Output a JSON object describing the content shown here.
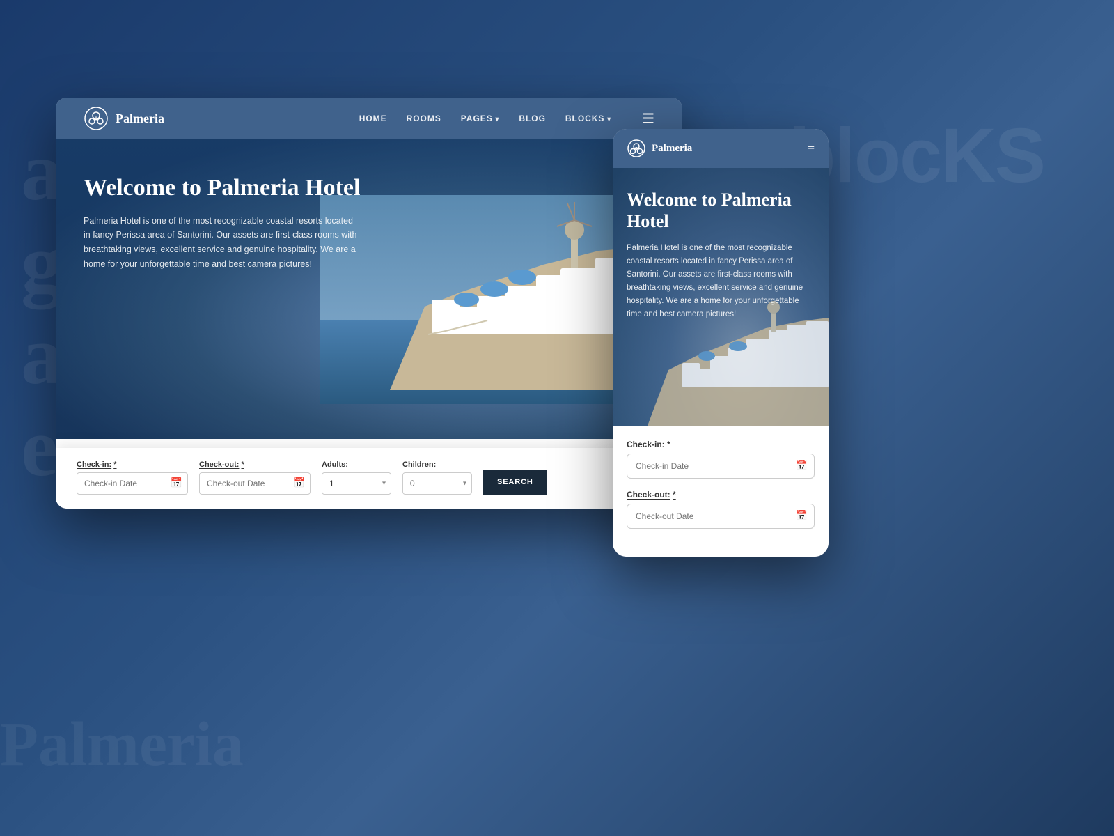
{
  "background": {
    "color": "#1e3a5f"
  },
  "watermark_text": "Palmeria",
  "blocks_text": "blocKS",
  "desktop": {
    "navbar": {
      "logo_text": "Palmeria",
      "nav_items": [
        {
          "label": "HOME",
          "has_dropdown": false
        },
        {
          "label": "ROOMS",
          "has_dropdown": false
        },
        {
          "label": "PAGES",
          "has_dropdown": true
        },
        {
          "label": "BLOG",
          "has_dropdown": false
        },
        {
          "label": "BLOCKS",
          "has_dropdown": true
        }
      ]
    },
    "hero": {
      "title": "Welcome to Palmeria Hotel",
      "description": "Palmeria Hotel is one of the most recognizable coastal resorts located in fancy Perissa area of Santorini. Our assets are first-class rooms with breathtaking views, excellent service and genuine hospitality. We are a home for your unforgettable time and best camera pictures!"
    },
    "booking": {
      "checkin_label": "Check-in:",
      "checkin_placeholder": "Check-in Date",
      "checkout_label": "Check-out:",
      "checkout_placeholder": "Check-out Date",
      "adults_label": "Adults:",
      "adults_default": "1",
      "children_label": "Children:",
      "children_default": "0",
      "search_button": "SEARCH"
    }
  },
  "mobile": {
    "navbar": {
      "logo_text": "Palmeria"
    },
    "hero": {
      "title": "Welcome to Palmeria Hotel",
      "description": "Palmeria Hotel is one of the most recognizable coastal resorts located in fancy Perissa area of Santorini. Our assets are first-class rooms with breathtaking views, excellent service and genuine hospitality. We are a home for your unforgettable time and best camera pictures!"
    },
    "booking": {
      "checkin_label": "Check-in:",
      "checkin_placeholder": "Check-in Date",
      "checkout_label": "Check-out:",
      "checkout_placeholder": "Check-out Date"
    }
  }
}
